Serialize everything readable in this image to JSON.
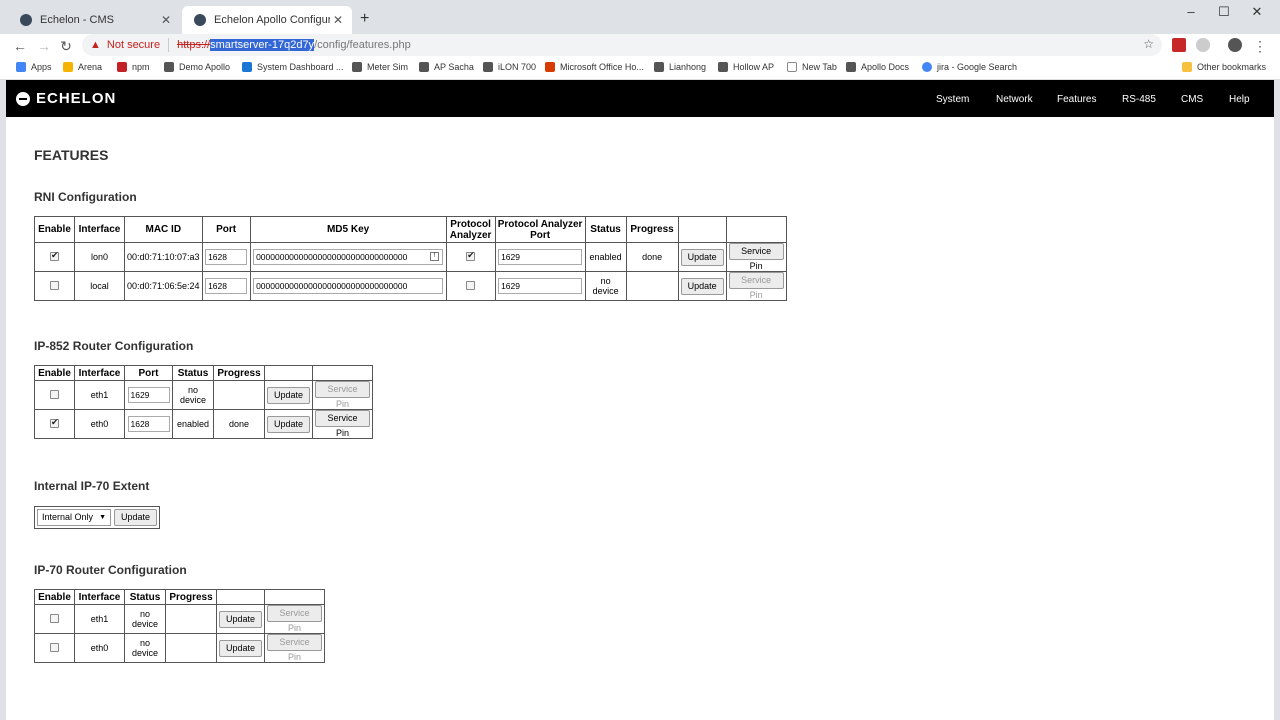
{
  "browser": {
    "tabs": [
      {
        "title": "Echelon - CMS"
      },
      {
        "title": "Echelon Apollo Configuration"
      }
    ],
    "address": {
      "security_label": "Not secure",
      "scheme": "https://",
      "host": "smartserver-17q2d7y",
      "path": "/config/features.php"
    },
    "bookmarks": [
      "Apps",
      "Arena",
      "npm",
      "Demo Apollo",
      "System Dashboard ...",
      "Meter Sim",
      "AP Sacha",
      "iLON 700",
      "Microsoft Office Ho...",
      "Lianhong",
      "Hollow AP",
      "New Tab",
      "Apollo Docs",
      "jira - Google Search"
    ],
    "other_bookmarks": "Other bookmarks"
  },
  "site": {
    "logo": "ECHELON",
    "nav": [
      "System",
      "Network",
      "Features",
      "RS-485",
      "CMS",
      "Help"
    ]
  },
  "page_title": "FEATURES",
  "rni": {
    "title": "RNI Configuration",
    "headers": [
      "Enable",
      "Interface",
      "MAC ID",
      "Port",
      "MD5 Key",
      "Protocol Analyzer",
      "Protocol Analyzer Port",
      "Status",
      "Progress",
      "",
      ""
    ],
    "rows": [
      {
        "enabled": true,
        "interface": "lon0",
        "mac": "00:d0:71:10:07:a3",
        "port": "1628",
        "md5": "00000000000000000000000000000000",
        "analyzer": true,
        "analyzer_port": "1629",
        "status": "enabled",
        "progress": "done",
        "update": "Update",
        "service": "Service Pin",
        "service_disabled": false
      },
      {
        "enabled": false,
        "interface": "local",
        "mac": "00:d0:71:06:5e:24",
        "port": "1628",
        "md5": "00000000000000000000000000000000",
        "analyzer": false,
        "analyzer_port": "1629",
        "status": "no device",
        "progress": "",
        "update": "Update",
        "service": "Service Pin",
        "service_disabled": true
      }
    ]
  },
  "ip852": {
    "title": "IP-852 Router Configuration",
    "headers": [
      "Enable",
      "Interface",
      "Port",
      "Status",
      "Progress",
      "",
      ""
    ],
    "rows": [
      {
        "enabled": false,
        "interface": "eth1",
        "port": "1629",
        "status": "no device",
        "progress": "",
        "update": "Update",
        "service": "Service Pin",
        "service_disabled": true
      },
      {
        "enabled": true,
        "interface": "eth0",
        "port": "1628",
        "status": "enabled",
        "progress": "done",
        "update": "Update",
        "service": "Service Pin",
        "service_disabled": false
      }
    ]
  },
  "extent": {
    "title": "Internal IP-70 Extent",
    "selected": "Internal Only",
    "update": "Update"
  },
  "ip70": {
    "title": "IP-70 Router Configuration",
    "headers": [
      "Enable",
      "Interface",
      "Status",
      "Progress",
      "",
      ""
    ],
    "rows": [
      {
        "enabled": false,
        "interface": "eth1",
        "status": "no device",
        "progress": "",
        "update": "Update",
        "service": "Service Pin",
        "service_disabled": true
      },
      {
        "enabled": false,
        "interface": "eth0",
        "status": "no device",
        "progress": "",
        "update": "Update",
        "service": "Service Pin",
        "service_disabled": true
      }
    ]
  }
}
